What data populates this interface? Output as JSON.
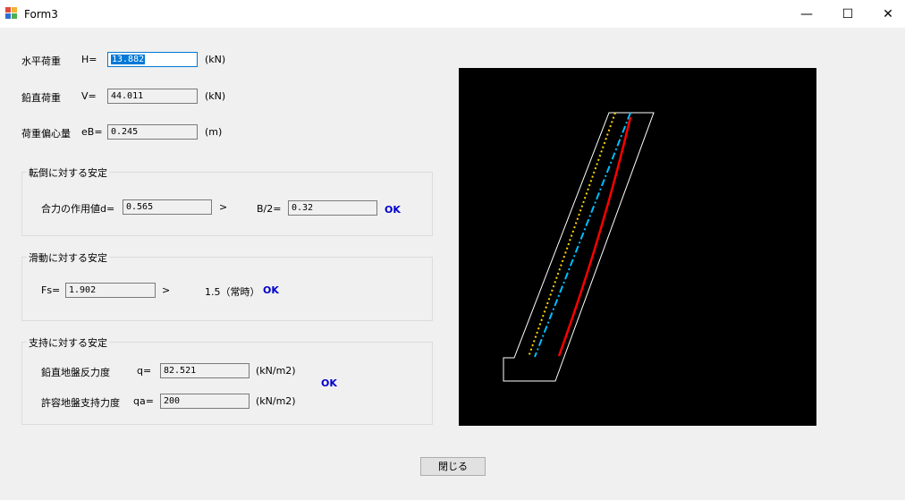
{
  "window": {
    "title": "Form3",
    "minimize": "—",
    "maximize": "☐",
    "close": "✕"
  },
  "horizontal_load": {
    "label": "水平荷重",
    "symbol": "H=",
    "value": "13.882",
    "unit": "(kN)"
  },
  "vertical_load": {
    "label": "鉛直荷重",
    "symbol": "V=",
    "value": "44.011",
    "unit": "(kN)"
  },
  "eccentricity": {
    "label": "荷重偏心量",
    "symbol": "eB=",
    "value": "0.245",
    "unit": "(m)"
  },
  "overturning": {
    "title": "転倒に対する安定",
    "resultant_label": "合力の作用値d=",
    "resultant_value": "0.565",
    "compare": ">",
    "half_b_label": "B/2=",
    "half_b_value": "0.32",
    "result": "OK"
  },
  "sliding": {
    "title": "滑動に対する安定",
    "fs_label": "Fs=",
    "fs_value": "1.902",
    "compare": ">",
    "criterion": "1.5（常時）",
    "result": "OK"
  },
  "bearing": {
    "title": "支持に対する安定",
    "q_label": "鉛直地盤反力度",
    "q_symbol": "q=",
    "q_value": "82.521",
    "q_unit": "(kN/m2)",
    "qa_label": "許容地盤支持力度",
    "qa_symbol": "qa=",
    "qa_value": "200",
    "qa_unit": "(kN/m2)",
    "result": "OK"
  },
  "buttons": {
    "close_label": "閉じる"
  },
  "colors": {
    "canvas_bg": "#000000",
    "wall_outline": "#ffffff",
    "dotted_line": "#ffd700",
    "dashdot_line": "#00bfff",
    "resultant_line": "#ff0000",
    "ok_text": "#0000cd"
  },
  "icons": {
    "app": "form-app-icon"
  }
}
